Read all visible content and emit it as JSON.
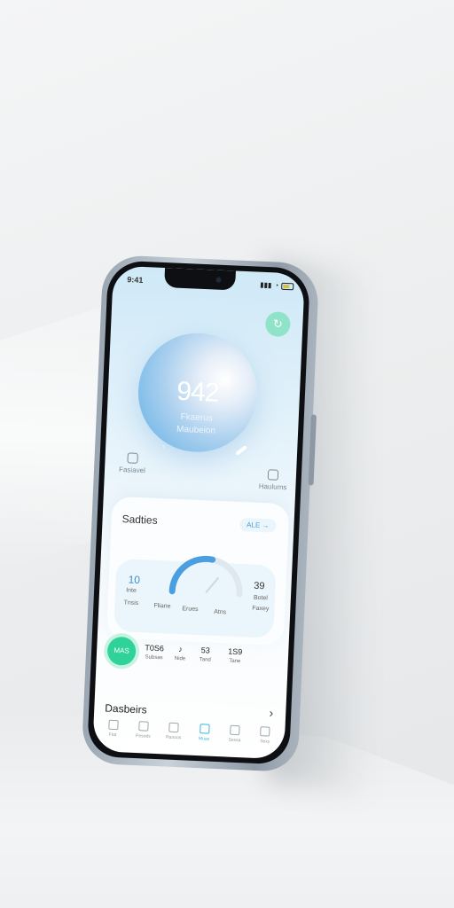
{
  "status": {
    "time": "9:41"
  },
  "orb": {
    "value": "942",
    "label_top": "Fkaerus",
    "label_bottom": "Maubeion",
    "chevron": "‹"
  },
  "quick": {
    "left_label": "Fasiavel",
    "right_label": "Haulums"
  },
  "card": {
    "title": "Sadties",
    "pill": "ALE →",
    "gauge": {
      "left_value": "10",
      "left_sub": "Inte",
      "left_sub2": "Tnsis",
      "right_value": "39",
      "right_sub": "Botel",
      "right_sub2": "Faxey",
      "mid1": "Fliane",
      "mid2": "Erues",
      "mid3": "Atns",
      "level": 0.55
    }
  },
  "stats": {
    "badge": "MAS",
    "items": [
      {
        "value": "T0S6",
        "sub": "Subsas"
      },
      {
        "value": "♪",
        "sub": "Nide"
      },
      {
        "value": "53",
        "sub": "Tand"
      },
      {
        "value": "1S9",
        "sub": "Tane"
      }
    ]
  },
  "dashboard": {
    "title": "Dasbeirs",
    "chevron": "›"
  },
  "tabs": [
    {
      "label": "Ftat"
    },
    {
      "label": "Pesods"
    },
    {
      "label": "Ranoos"
    },
    {
      "label": "Muas"
    },
    {
      "label": "Sessa"
    },
    {
      "label": "Sexy"
    }
  ],
  "colors": {
    "accent": "#3d8fd0",
    "green": "#2fd39a",
    "avatar": "#8fe3c9"
  }
}
